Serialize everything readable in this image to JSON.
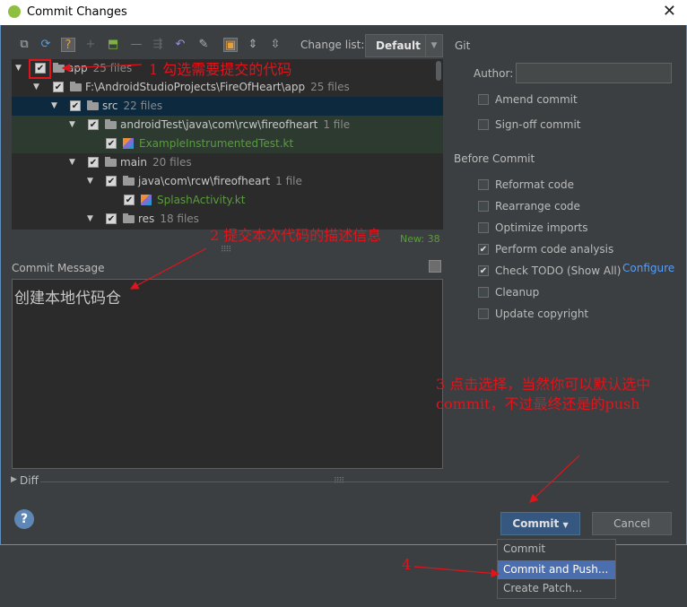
{
  "window": {
    "title": "Commit Changes",
    "close_glyph": "✕"
  },
  "toolbar": {
    "icons": [
      "diff-icon",
      "refresh-icon",
      "show-unversioned-icon",
      "expand-icon",
      "add-icon",
      "remove-icon",
      "move-icon",
      "rollback-icon",
      "edit-source-icon",
      "group-by-directory-icon",
      "expand-all-icon",
      "collapse-all-icon"
    ],
    "change_list_label": "Change list:",
    "change_list_value": "Default"
  },
  "tree": {
    "rows": [
      {
        "name": "app",
        "count": "25 files"
      },
      {
        "name": "F:\\AndroidStudioProjects\\FireOfHeart\\app",
        "count": "25 files"
      },
      {
        "name": "src",
        "count": "22 files"
      },
      {
        "name": "androidTest\\java\\com\\rcw\\fireofheart",
        "count": "1 file"
      },
      {
        "name": "ExampleInstrumentedTest.kt",
        "count": ""
      },
      {
        "name": "main",
        "count": "20 files"
      },
      {
        "name": "java\\com\\rcw\\fireofheart",
        "count": "1 file"
      },
      {
        "name": "SplashActivity.kt",
        "count": ""
      },
      {
        "name": "res",
        "count": "18 files"
      }
    ],
    "new_count": "New: 38"
  },
  "commit_message": {
    "label": "Commit Message",
    "text": "创建本地代码仓"
  },
  "diff": {
    "label": "Diff"
  },
  "git": {
    "section_label": "Git",
    "author_label": "Author:",
    "author_value": "",
    "amend": "Amend commit",
    "signoff": "Sign-off commit"
  },
  "before_commit": {
    "label": "Before Commit",
    "options": [
      {
        "label": "Reformat code",
        "checked": false
      },
      {
        "label": "Rearrange code",
        "checked": false
      },
      {
        "label": "Optimize imports",
        "checked": false
      },
      {
        "label": "Perform code analysis",
        "checked": true
      },
      {
        "label": "Check TODO (Show All)",
        "checked": true
      },
      {
        "label": "Cleanup",
        "checked": false
      },
      {
        "label": "Update copyright",
        "checked": false
      }
    ],
    "configure": "Configure"
  },
  "buttons": {
    "help": "?",
    "commit": "Commit",
    "cancel": "Cancel"
  },
  "dropdown": {
    "items": [
      "Commit",
      "Commit and Push...",
      "Create Patch..."
    ],
    "selected": "Commit and Push..."
  },
  "annotations": {
    "a1": "1  勾选需要提交的代码",
    "a2": "2  提交本次代码的描述信息",
    "a3": "3  点击选择，当然你可以默认选中commit，不过最终还是的push",
    "a4": "4"
  },
  "colors": {
    "accent": "#4b6eaf",
    "annotation": "#e0141b",
    "selected_row": "#0d293e",
    "added_file": "#5a9c3c"
  }
}
